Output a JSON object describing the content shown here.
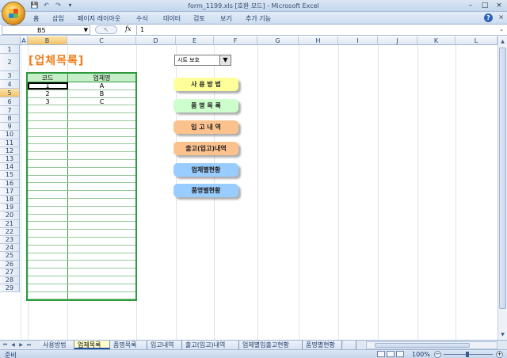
{
  "window": {
    "title": "form_1199.xls  [호환 모드] - Microsoft Excel",
    "controls": [
      "–",
      "□",
      "×"
    ]
  },
  "quick_access": [
    "💾",
    "↶",
    "↷",
    "▾"
  ],
  "ribbon_tabs": [
    "홈",
    "삽입",
    "페이지 레이아웃",
    "수식",
    "데이터",
    "검토",
    "보기",
    "추가 기능"
  ],
  "formula_bar": {
    "cell_ref": "B5",
    "fx": "fx",
    "value": "1"
  },
  "columns": [
    "A",
    "B",
    "C",
    "D",
    "E",
    "F",
    "G",
    "H",
    "I",
    "J",
    "K",
    "L"
  ],
  "selected_column": "B",
  "rows": [
    "1",
    "2",
    "3",
    "4",
    "5",
    "6",
    "7",
    "8",
    "9",
    "10",
    "11",
    "12",
    "13",
    "14",
    "15",
    "16",
    "17",
    "18",
    "19",
    "20",
    "21",
    "22",
    "23",
    "24",
    "25",
    "26",
    "27",
    "28",
    "29"
  ],
  "selected_row": "5",
  "sheet": {
    "title": "[업체목록]",
    "table_header": {
      "code": "코드",
      "name": "업체명"
    },
    "table_rows": [
      {
        "code": "1",
        "name": "A"
      },
      {
        "code": "2",
        "name": "B"
      },
      {
        "code": "3",
        "name": "C"
      }
    ],
    "empty_rows": 25,
    "combo": {
      "value": "시트 보호",
      "arrow": "▼"
    },
    "buttons": [
      {
        "label": "사 용 방 법",
        "color": "#ffff99"
      },
      {
        "label": "품 명 목 록",
        "color": "#ccffcc"
      },
      {
        "label": "입 고 내 역",
        "color": "#fcc28e"
      },
      {
        "label": "출고(입고)내역",
        "color": "#fcc28e"
      },
      {
        "label": "업체별현황",
        "color": "#99ccff"
      },
      {
        "label": "품명별현황",
        "color": "#99ccff"
      }
    ]
  },
  "sheet_tabs": [
    "사용방법",
    "업체목록",
    "품명목록",
    "입고내역",
    "출고(입고)내역",
    "업체별입출고현황",
    "품명별현황"
  ],
  "active_sheet_tab": "업체목록",
  "status": {
    "ready": "준비",
    "zoom": "100%",
    "zoom_minus": "−",
    "zoom_plus": "+",
    "zoom_level": 1.0
  }
}
